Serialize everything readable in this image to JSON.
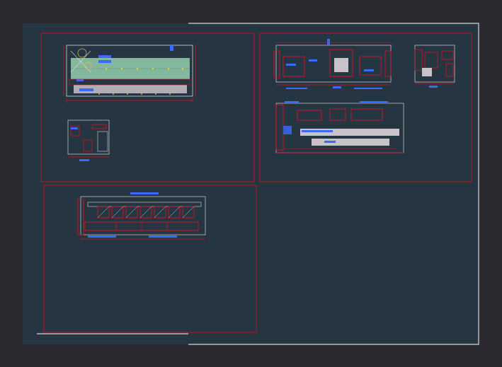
{
  "colors": {
    "background": "#2b2a31",
    "model_space": "#253541",
    "sheet_border": "#d8d8d8",
    "viewport_border": "#c0121e",
    "dimension": "#e0101e",
    "annotation": "#3a6bff",
    "linework": "#d4d4d4",
    "tile_fill": "#8fc7a8",
    "accent_yellow": "#e8d040"
  },
  "views": [
    {
      "id": "plan-1",
      "icon": "floor-plan-icon"
    },
    {
      "id": "section-small-1",
      "icon": "elevation-icon"
    },
    {
      "id": "elevation-wall",
      "icon": "elevation-icon"
    },
    {
      "id": "elevation-a",
      "icon": "elevation-icon"
    },
    {
      "id": "elevation-b",
      "icon": "elevation-icon"
    },
    {
      "id": "elevation-c",
      "icon": "elevation-icon"
    }
  ]
}
